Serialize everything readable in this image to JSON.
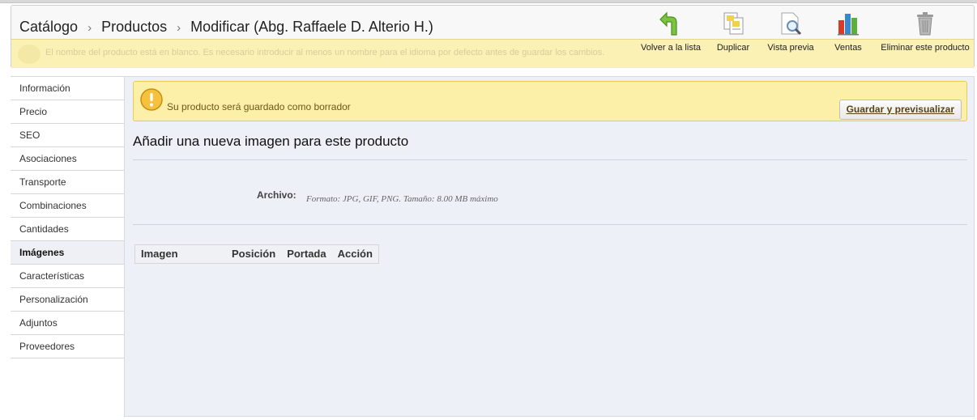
{
  "breadcrumb": {
    "items": [
      "Catálogo",
      "Productos",
      "Modificar (Abg. Raffaele D. Alterio H.)"
    ],
    "separator": "›"
  },
  "background_warning": "El nombre del producto está en blanco. Es necesario introducir al menos un nombre para el idioma por defecto antes de guardar los cambios.",
  "toolbar": {
    "actions": [
      {
        "label": "Volver a la lista",
        "icon": "back-arrow-icon"
      },
      {
        "label": "Duplicar",
        "icon": "duplicate-icon"
      },
      {
        "label": "Vista previa",
        "icon": "preview-magnifier-icon"
      },
      {
        "label": "Ventas",
        "icon": "sales-chart-icon"
      },
      {
        "label": "Eliminar este producto",
        "icon": "trash-icon"
      }
    ]
  },
  "sidebar": {
    "items": [
      {
        "label": "Información",
        "active": false
      },
      {
        "label": "Precio",
        "active": false
      },
      {
        "label": "SEO",
        "active": false
      },
      {
        "label": "Asociaciones",
        "active": false
      },
      {
        "label": "Transporte",
        "active": false
      },
      {
        "label": "Combinaciones",
        "active": false
      },
      {
        "label": "Cantidades",
        "active": false
      },
      {
        "label": "Imágenes",
        "active": true
      },
      {
        "label": "Características",
        "active": false
      },
      {
        "label": "Personalización",
        "active": false
      },
      {
        "label": "Adjuntos",
        "active": false
      },
      {
        "label": "Proveedores",
        "active": false
      }
    ]
  },
  "notice": {
    "text": "Su producto será guardado como borrador",
    "button_label": "Guardar y previsualizar",
    "icon": "warning-icon"
  },
  "main": {
    "title": "Añadir una nueva imagen para este producto",
    "file_label": "Archivo:",
    "file_hint": "Formato: JPG, GIF, PNG. Tamaño: 8.00 MB máximo",
    "table_headers": [
      "Imagen",
      "Posición",
      "Portada",
      "Acción"
    ]
  },
  "colors": {
    "notice_bg": "#fcefa7",
    "panel_bg": "#edf0f7",
    "ventas_red": "#d83a2a",
    "ventas_blue": "#3a86d1",
    "ventas_green": "#5bb03b"
  }
}
